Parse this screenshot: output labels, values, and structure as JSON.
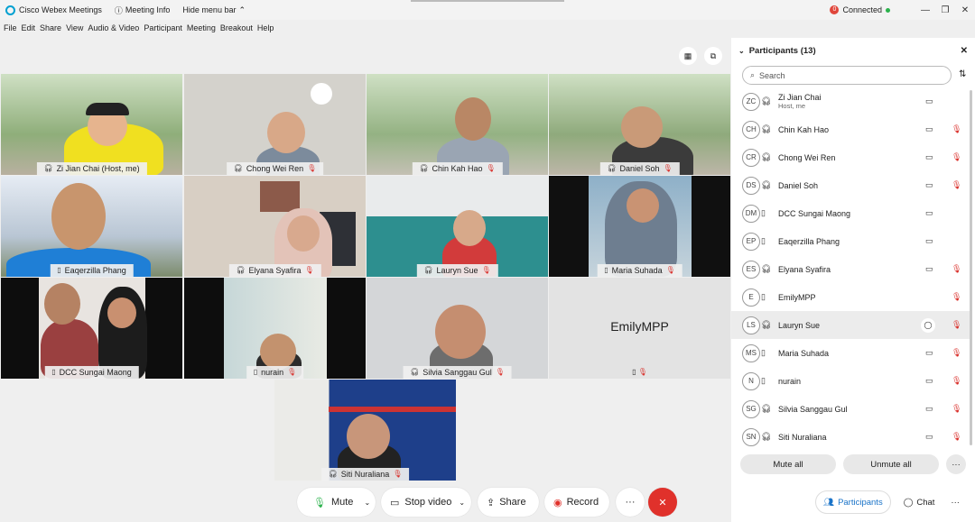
{
  "titlebar": {
    "app_title": "Cisco Webex Meetings",
    "meeting_info": "Meeting Info",
    "hide_menu": "Hide menu bar",
    "status": "Connected"
  },
  "menu": [
    "File",
    "Edit",
    "Share",
    "View",
    "Audio & Video",
    "Participant",
    "Meeting",
    "Breakout",
    "Help"
  ],
  "tiles": [
    {
      "name": "Zi Jian Chai (Host, me)"
    },
    {
      "name": "Chong Wei Ren"
    },
    {
      "name": "Chin Kah Hao"
    },
    {
      "name": "Daniel Soh"
    },
    {
      "name": "Eaqerzilla Phang"
    },
    {
      "name": "Elyana Syafira"
    },
    {
      "name": "Lauryn Sue"
    },
    {
      "name": "Maria Suhada"
    },
    {
      "name": "DCC Sungai Maong"
    },
    {
      "name": "nurain"
    },
    {
      "name": "Silvia Sanggau Gul"
    },
    {
      "name": "",
      "label": "EmilyMPP"
    },
    {
      "name": "Siti Nuraliana"
    }
  ],
  "controls": {
    "mute": "Mute",
    "stop_video": "Stop video",
    "share": "Share",
    "record": "Record",
    "more": "···",
    "end": "✕"
  },
  "panel": {
    "title": "Participants (13)",
    "search_placeholder": "Search",
    "participants": [
      {
        "initials": "ZC",
        "name": "Zi Jian Chai",
        "sub": "Host, me"
      },
      {
        "initials": "CH",
        "name": "Chin Kah Hao"
      },
      {
        "initials": "CR",
        "name": "Chong Wei Ren"
      },
      {
        "initials": "DS",
        "name": "Daniel Soh"
      },
      {
        "initials": "DM",
        "name": "DCC Sungai Maong"
      },
      {
        "initials": "EP",
        "name": "Eaqerzilla Phang"
      },
      {
        "initials": "ES",
        "name": "Elyana Syafira"
      },
      {
        "initials": "E",
        "name": "EmilyMPP"
      },
      {
        "initials": "LS",
        "name": "Lauryn Sue"
      },
      {
        "initials": "MS",
        "name": "Maria Suhada"
      },
      {
        "initials": "N",
        "name": "nurain"
      },
      {
        "initials": "SG",
        "name": "Silvia Sanggau Gul"
      },
      {
        "initials": "SN",
        "name": "Siti Nuraliana"
      }
    ],
    "mute_all": "Mute all",
    "unmute_all": "Unmute all",
    "more": "···"
  },
  "bottom_tabs": {
    "participants": "Participants",
    "chat": "Chat",
    "more": "···"
  },
  "colors": {
    "accent": "#1a73c8",
    "danger": "#e0312b",
    "mic_on": "#2bb24c"
  }
}
